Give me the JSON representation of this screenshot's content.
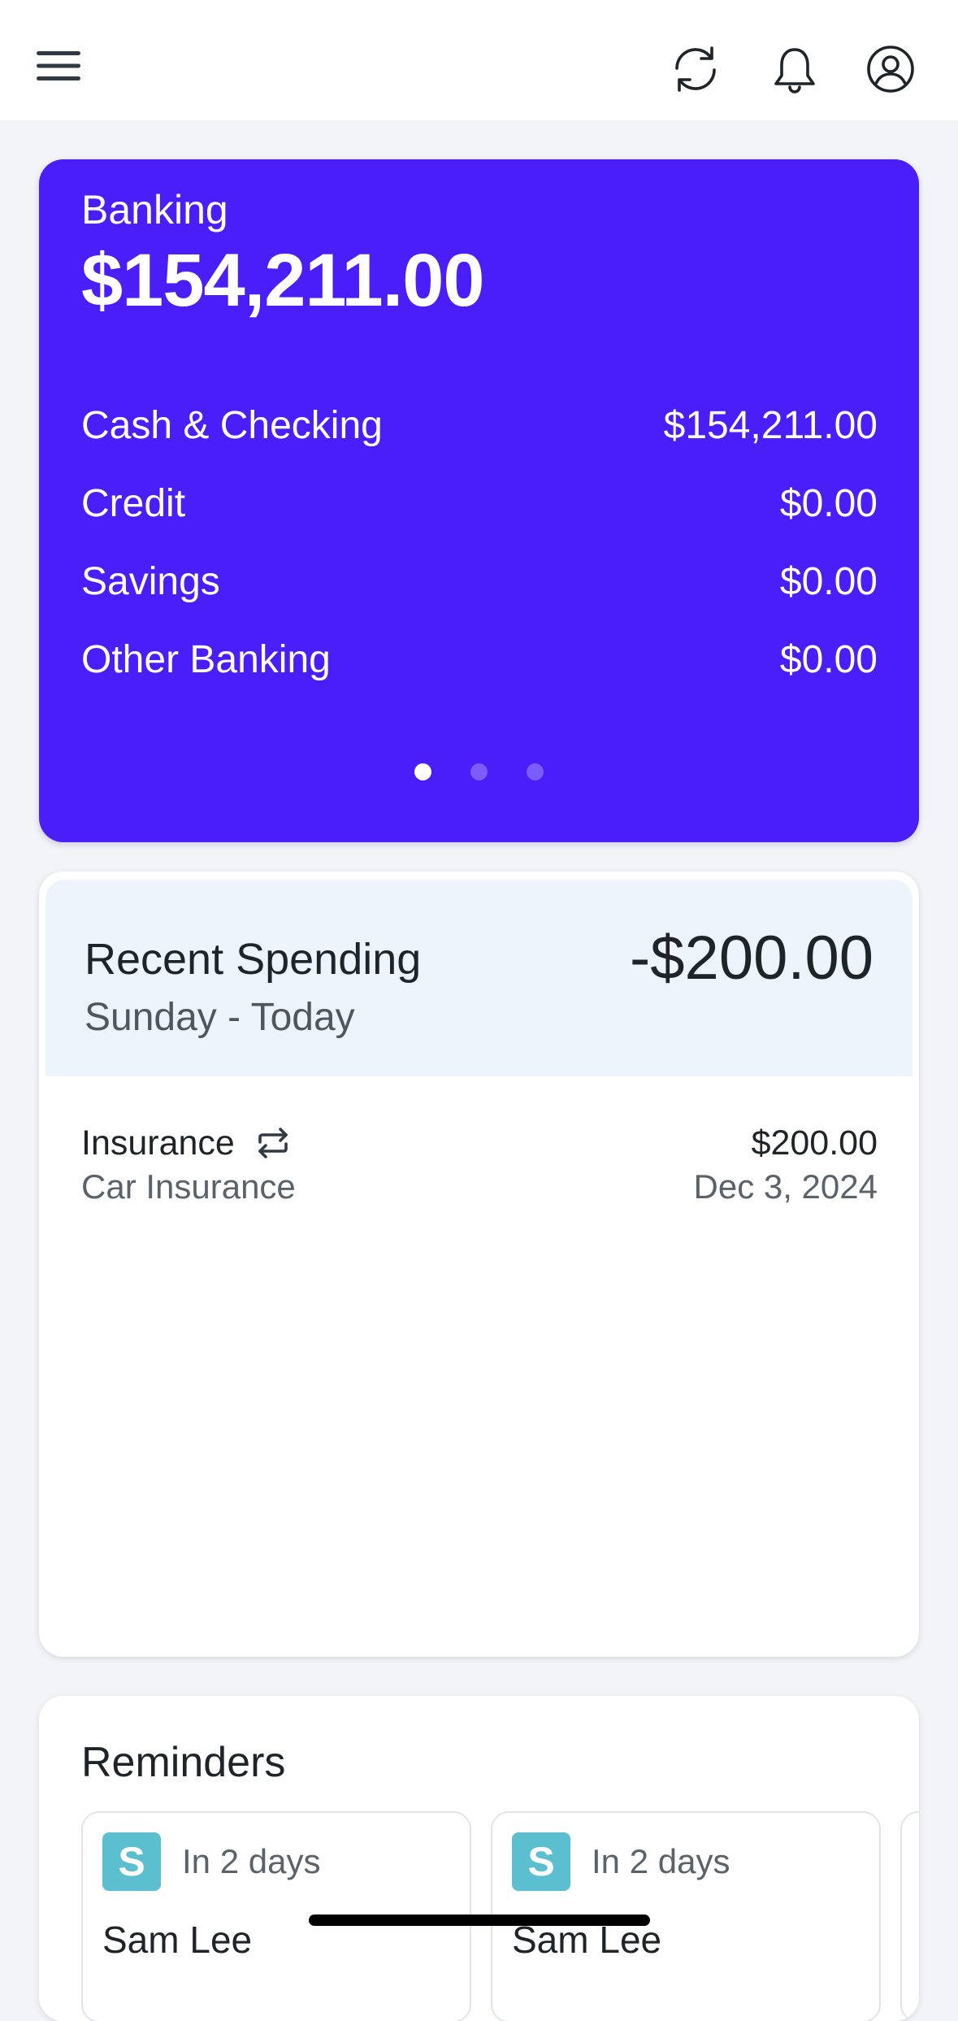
{
  "header": {
    "icons": [
      "menu-icon",
      "sync-icon",
      "bell-icon",
      "user-icon"
    ]
  },
  "banking": {
    "title": "Banking",
    "total": "$154,211.00",
    "rows": [
      {
        "label": "Cash & Checking",
        "value": "$154,211.00"
      },
      {
        "label": "Credit",
        "value": "$0.00"
      },
      {
        "label": "Savings",
        "value": "$0.00"
      },
      {
        "label": "Other Banking",
        "value": "$0.00"
      }
    ],
    "pages": {
      "count": 3,
      "active": 1
    },
    "accent": "#4a1ef9"
  },
  "spending": {
    "title": "Recent Spending",
    "subtitle": "Sunday - Today",
    "total": "-$200.00",
    "transactions": [
      {
        "category": "Insurance",
        "description": "Car Insurance",
        "amount": "$200.00",
        "date": "Dec 3, 2024",
        "icon": "recurring-icon"
      }
    ]
  },
  "reminders": {
    "title": "Reminders",
    "items": [
      {
        "avatar": "S",
        "when": "In 2 days",
        "name": "Sam Lee"
      },
      {
        "avatar": "S",
        "when": "In 2 days",
        "name": "Sam Lee"
      }
    ],
    "avatar_color": "#5bbfd0"
  }
}
